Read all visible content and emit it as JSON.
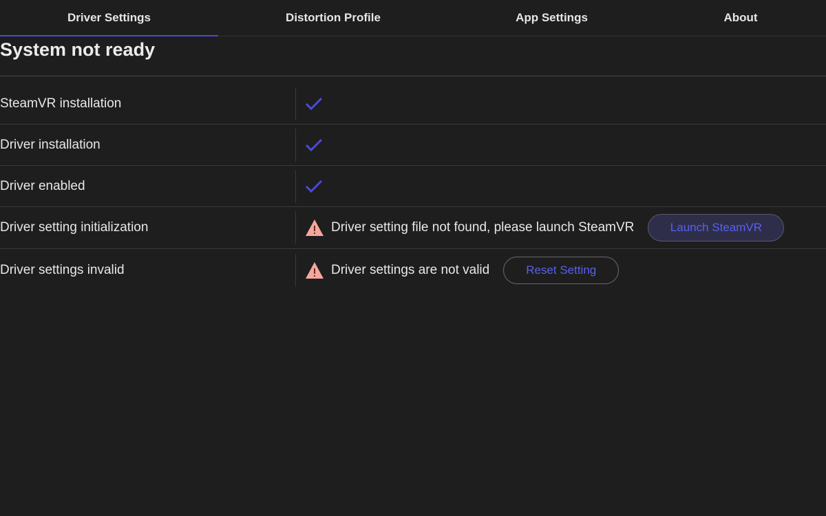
{
  "tabs": [
    {
      "label": "Driver Settings",
      "active": true
    },
    {
      "label": "Distortion Profile",
      "active": false
    },
    {
      "label": "App Settings",
      "active": false
    },
    {
      "label": "About",
      "active": false
    }
  ],
  "status_title": "System not ready",
  "checks": [
    {
      "label": "SteamVR installation",
      "status": "ok"
    },
    {
      "label": "Driver installation",
      "status": "ok"
    },
    {
      "label": "Driver enabled",
      "status": "ok"
    },
    {
      "label": "Driver setting initialization",
      "status": "warning",
      "message": "Driver setting file not found, please launch SteamVR",
      "action": "Launch SteamVR"
    },
    {
      "label": "Driver settings invalid",
      "status": "warning",
      "message": "Driver settings are not valid",
      "action": "Reset Setting"
    }
  ],
  "colors": {
    "accent": "#4a4adf",
    "check": "#4a4adf",
    "warning": "#f4a79d",
    "background": "#1e1e1e"
  },
  "icons": {
    "ok": "check-icon",
    "warning": "warning-triangle-icon"
  }
}
